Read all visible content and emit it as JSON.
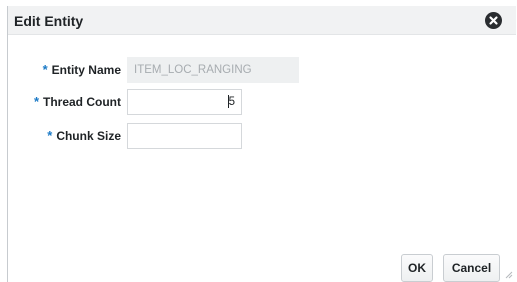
{
  "dialog": {
    "title": "Edit Entity",
    "close_icon": "close-circle-icon"
  },
  "form": {
    "required_marker": "*",
    "entity_name": {
      "label": "Entity Name",
      "value": "ITEM_LOC_RANGING",
      "readonly": true
    },
    "thread_count": {
      "label": "Thread Count",
      "value": "5"
    },
    "chunk_size": {
      "label": "Chunk Size",
      "value": ""
    }
  },
  "buttons": {
    "ok_label": "OK",
    "cancel_label": "Cancel"
  },
  "colors": {
    "required_accent": "#1a79c6",
    "titlebar_bg": "#f1f2f3"
  }
}
